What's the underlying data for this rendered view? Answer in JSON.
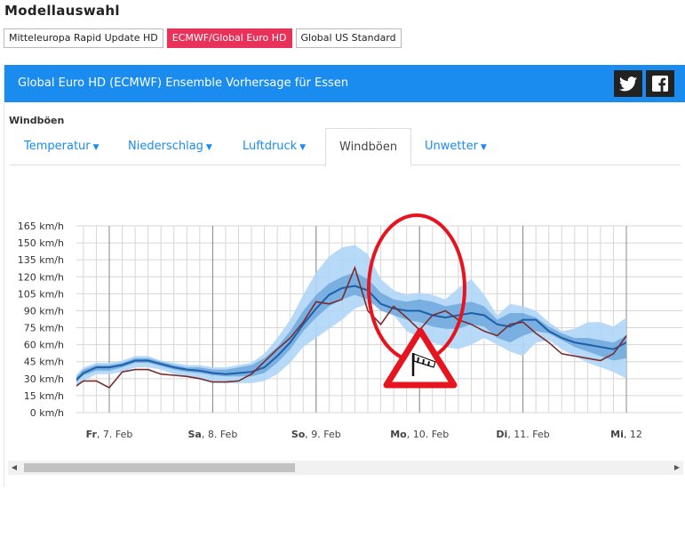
{
  "page": {
    "title": "Modellauswahl"
  },
  "models": [
    {
      "label": "Mitteleuropa Rapid Update HD",
      "active": false
    },
    {
      "label": "ECMWF/Global Euro HD",
      "active": true
    },
    {
      "label": "Global US Standard",
      "active": false
    }
  ],
  "banner": {
    "title": "Global Euro HD (ECMWF) Ensemble Vorhersage für Essen",
    "color": "#1a8cef"
  },
  "social": {
    "twitter_icon": "twitter-icon",
    "facebook_icon": "facebook-icon"
  },
  "tabs": [
    {
      "label": "Temperatur",
      "dropdown": true
    },
    {
      "label": "Niederschlag",
      "dropdown": true
    },
    {
      "label": "Luftdruck",
      "dropdown": true
    },
    {
      "label": "Windböen",
      "dropdown": false,
      "active": true
    },
    {
      "label": "Unwetter",
      "dropdown": true
    }
  ],
  "chart_label": "Windböen",
  "warning_icon": "wind-warning-icon",
  "chart_data": {
    "type": "area",
    "ylim": [
      0,
      165
    ],
    "yticks": [
      0,
      15,
      30,
      45,
      60,
      75,
      90,
      105,
      120,
      135,
      150,
      165
    ],
    "yunit": "km/h",
    "xlim": [
      0,
      6
    ],
    "day_ticks": [
      {
        "x": 1,
        "bold": "Fr",
        "rest": ", 7. Feb"
      },
      {
        "x": 2,
        "bold": "Sa",
        "rest": ", 8. Feb"
      },
      {
        "x": 3,
        "bold": "So",
        "rest": ", 9. Feb"
      },
      {
        "x": 4,
        "bold": "Mo",
        "rest": ", 10. Feb"
      },
      {
        "x": 5,
        "bold": "Di",
        "rest": ", 11. Feb"
      },
      {
        "x": 6,
        "bold": "Mi",
        "rest": ", 12"
      }
    ],
    "x": [
      0,
      0.125,
      0.25,
      0.375,
      0.5,
      0.625,
      0.75,
      0.875,
      1.0,
      1.125,
      1.25,
      1.375,
      1.5,
      1.625,
      1.75,
      1.875,
      2.0,
      2.125,
      2.25,
      2.375,
      2.5,
      2.625,
      2.75,
      2.875,
      3.0,
      3.125,
      3.25,
      3.375,
      3.5,
      3.625,
      3.75,
      3.875,
      4.0,
      4.125,
      4.25,
      4.375,
      4.5,
      4.625,
      4.75,
      4.875,
      5.0,
      5.125,
      5.25,
      5.375,
      5.5,
      5.625,
      5.75,
      5.875,
      6.0
    ],
    "series": [
      {
        "name": "min-max",
        "color": "#aed6f6",
        "lower": [
          20,
          13,
          9,
          7,
          12,
          18,
          28,
          34,
          34,
          36,
          40,
          40,
          38,
          34,
          32,
          30,
          28,
          26,
          26,
          26,
          28,
          34,
          44,
          58,
          66,
          74,
          82,
          92,
          96,
          96,
          86,
          72,
          66,
          62,
          58,
          56,
          60,
          66,
          60,
          54,
          50,
          62,
          64,
          56,
          50,
          44,
          40,
          36,
          30
        ],
        "upper": [
          24,
          18,
          15,
          13,
          20,
          28,
          40,
          44,
          44,
          46,
          50,
          50,
          46,
          44,
          42,
          42,
          40,
          40,
          42,
          44,
          52,
          66,
          82,
          104,
          124,
          138,
          146,
          148,
          140,
          118,
          108,
          104,
          106,
          104,
          100,
          110,
          118,
          104,
          86,
          96,
          94,
          90,
          80,
          72,
          74,
          80,
          80,
          76,
          84
        ]
      },
      {
        "name": "quartile",
        "color": "#6fa8dd",
        "lower": [
          21,
          15,
          11,
          9,
          14,
          22,
          33,
          37,
          37,
          40,
          44,
          44,
          41,
          38,
          36,
          35,
          33,
          32,
          32,
          32,
          35,
          44,
          56,
          72,
          84,
          94,
          100,
          104,
          100,
          90,
          86,
          82,
          80,
          76,
          74,
          74,
          78,
          76,
          66,
          62,
          68,
          72,
          70,
          64,
          58,
          54,
          50,
          46,
          48
        ],
        "upper": [
          23,
          17,
          13,
          11,
          18,
          26,
          38,
          42,
          42,
          44,
          48,
          48,
          45,
          42,
          40,
          40,
          38,
          38,
          40,
          42,
          48,
          58,
          72,
          90,
          104,
          114,
          120,
          124,
          118,
          106,
          100,
          98,
          100,
          98,
          94,
          96,
          98,
          94,
          82,
          88,
          88,
          84,
          76,
          70,
          66,
          66,
          64,
          62,
          68
        ]
      },
      {
        "name": "median",
        "color": "#1f5fa8",
        "values": [
          22,
          16,
          12,
          10,
          15,
          24,
          35,
          40,
          40,
          42,
          46,
          46,
          43,
          40,
          38,
          37,
          35,
          34,
          35,
          36,
          40,
          50,
          62,
          78,
          92,
          104,
          110,
          112,
          108,
          96,
          92,
          90,
          90,
          86,
          84,
          86,
          88,
          86,
          78,
          76,
          82,
          82,
          72,
          66,
          62,
          60,
          58,
          56,
          62
        ]
      },
      {
        "name": "control",
        "color": "#7a2b2b",
        "values": [
          22,
          15,
          12,
          9,
          13,
          20,
          28,
          28,
          22,
          36,
          38,
          38,
          34,
          33,
          32,
          30,
          27,
          27,
          28,
          34,
          45,
          56,
          66,
          80,
          98,
          96,
          100,
          128,
          90,
          78,
          94,
          84,
          73,
          86,
          90,
          82,
          78,
          72,
          68,
          78,
          80,
          70,
          62,
          52,
          50,
          48,
          46,
          52,
          68
        ]
      }
    ]
  }
}
